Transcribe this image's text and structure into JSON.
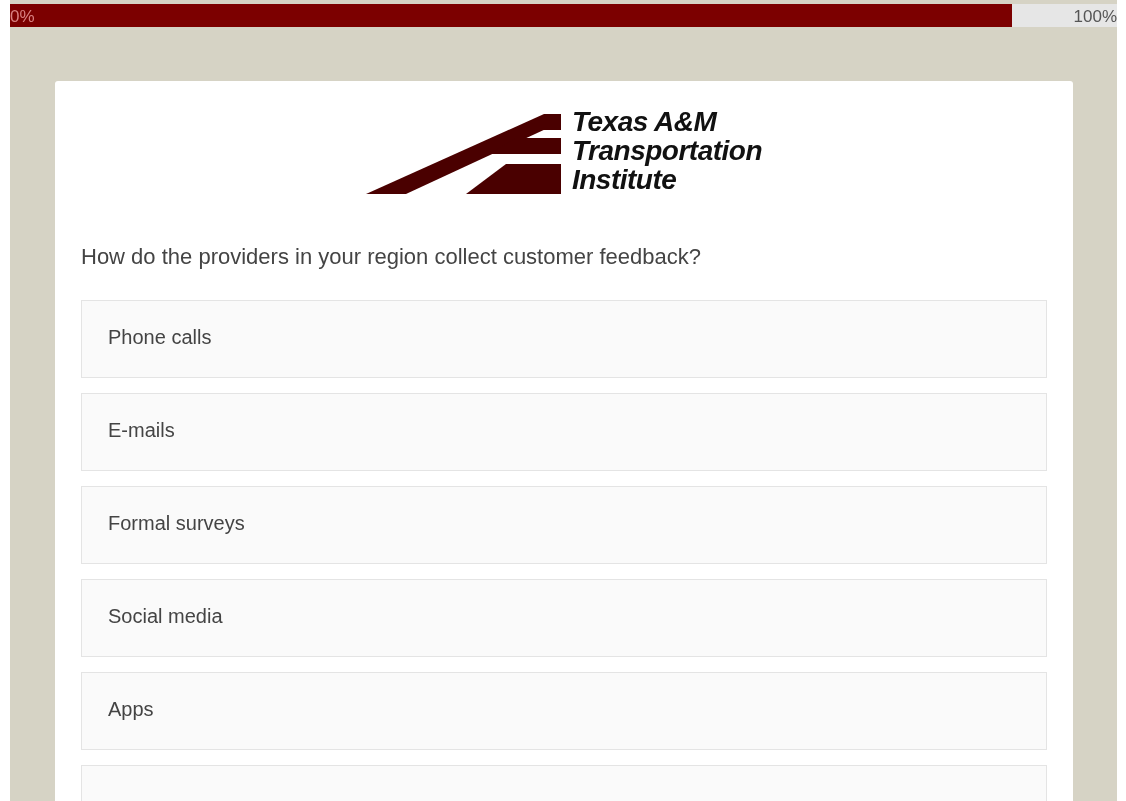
{
  "progress": {
    "start_label": "0%",
    "end_label": "100%",
    "level": 0.905
  },
  "logo": {
    "lines": [
      "Texas A&M",
      "Transportation",
      "Institute"
    ]
  },
  "question": "How do the providers in your region collect customer feedback?",
  "options": [
    {
      "label": "Phone calls"
    },
    {
      "label": "E-mails"
    },
    {
      "label": "Formal surveys"
    },
    {
      "label": "Social media"
    },
    {
      "label": "Apps"
    }
  ],
  "more_options_below": true
}
